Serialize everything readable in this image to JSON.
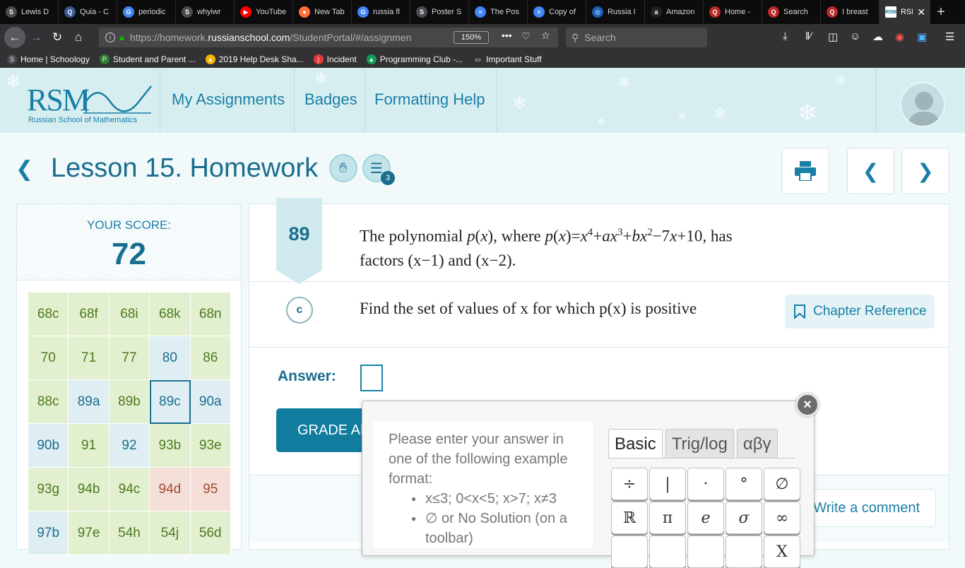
{
  "browser": {
    "tabs": [
      {
        "label": "Lewis D",
        "icon": "S",
        "color": "#4a4a4f"
      },
      {
        "label": "Quia - C",
        "icon": "Q",
        "color": "#3b5998"
      },
      {
        "label": "periodic",
        "icon": "G",
        "color": "#4285f4"
      },
      {
        "label": "whyiwr",
        "icon": "S",
        "color": "#4a4a4f"
      },
      {
        "label": "YouTube",
        "icon": "▶",
        "color": "#ff0000"
      },
      {
        "label": "New Tab",
        "icon": "●",
        "color": "#ff7139"
      },
      {
        "label": "russia fl",
        "icon": "G",
        "color": "#4285f4"
      },
      {
        "label": "Poster S",
        "icon": "S",
        "color": "#4a4a4f"
      },
      {
        "label": "The Pos",
        "icon": "≡",
        "color": "#4285f4"
      },
      {
        "label": "Copy of",
        "icon": "≡",
        "color": "#4285f4"
      },
      {
        "label": "Russia I",
        "icon": "◎",
        "color": "#1a5fb4"
      },
      {
        "label": "Amazon",
        "icon": "a",
        "color": "#222"
      },
      {
        "label": "Home -",
        "icon": "Q",
        "color": "#b92b27"
      },
      {
        "label": "Search",
        "icon": "Q",
        "color": "#b92b27"
      },
      {
        "label": "I breast",
        "icon": "Q",
        "color": "#b92b27"
      }
    ],
    "active_tab": {
      "label": "RSM",
      "icon": "RSM"
    },
    "new_tab": "+",
    "url_prefix": "https://homework.",
    "url_domain": "russianschool.com",
    "url_rest": "/StudentPortal/#/assignmen",
    "zoom": "150%",
    "search_placeholder": "Search",
    "bookmarks": [
      {
        "label": "Home | Schoology",
        "icon": "S"
      },
      {
        "label": "Student and Parent ...",
        "icon": "P"
      },
      {
        "label": "2019 Help Desk Sha...",
        "icon": "▲"
      },
      {
        "label": "Incident",
        "icon": ")"
      },
      {
        "label": "Programming Club -...",
        "icon": "▲"
      },
      {
        "label": "Important Stuff",
        "icon": "▭"
      }
    ]
  },
  "header": {
    "logo_text": "RSM",
    "logo_sub": "Russian School of Mathematics",
    "nav": [
      "My Assignments",
      "Badges",
      "Formatting Help"
    ]
  },
  "page": {
    "title": "Lesson 15. Homework",
    "badge_count": "3"
  },
  "score": {
    "label": "YOUR SCORE:",
    "value": "72",
    "problems": [
      {
        "id": "68c",
        "status": "g"
      },
      {
        "id": "68f",
        "status": "g"
      },
      {
        "id": "68i",
        "status": "g"
      },
      {
        "id": "68k",
        "status": "g"
      },
      {
        "id": "68n",
        "status": "g"
      },
      {
        "id": "70",
        "status": "g"
      },
      {
        "id": "71",
        "status": "g"
      },
      {
        "id": "77",
        "status": "g"
      },
      {
        "id": "80",
        "status": "b"
      },
      {
        "id": "86",
        "status": "g"
      },
      {
        "id": "88c",
        "status": "g"
      },
      {
        "id": "89a",
        "status": "b"
      },
      {
        "id": "89b",
        "status": "g"
      },
      {
        "id": "89c",
        "status": "sel"
      },
      {
        "id": "90a",
        "status": "b"
      },
      {
        "id": "90b",
        "status": "b"
      },
      {
        "id": "91",
        "status": "g"
      },
      {
        "id": "92",
        "status": "b"
      },
      {
        "id": "93b",
        "status": "g"
      },
      {
        "id": "93e",
        "status": "g"
      },
      {
        "id": "93g",
        "status": "g"
      },
      {
        "id": "94b",
        "status": "g"
      },
      {
        "id": "94c",
        "status": "g"
      },
      {
        "id": "94d",
        "status": "r"
      },
      {
        "id": "95",
        "status": "r"
      },
      {
        "id": "97b",
        "status": "b"
      },
      {
        "id": "97e",
        "status": "g"
      },
      {
        "id": "54h",
        "status": "g"
      },
      {
        "id": "54j",
        "status": "g"
      },
      {
        "id": "56d",
        "status": "g"
      }
    ]
  },
  "problem": {
    "number": "89",
    "statement_line1_pre": "The polynomial ",
    "statement_line2": "factors (x−1) and (x−2).",
    "part": "c",
    "part_text": "Find the set of values of x for which p(x) is positive",
    "chapter_reference": "Chapter Reference",
    "answer_label": "Answer:",
    "grade_button": "GRADE AN",
    "comment_button": "Write a comment"
  },
  "keyboard": {
    "close": "×",
    "help_intro": "Please enter your answer in one of the following example format:",
    "examples": [
      "x≤3; 0<x<5; x>7; x≠3",
      "∅ or No Solution (on a toolbar)"
    ],
    "tabs": [
      "Basic",
      "Trig/log",
      "αβγ"
    ],
    "active_tab": "Basic",
    "keys": [
      "÷",
      "|",
      "·",
      "°",
      "∅",
      "ℝ",
      "π",
      "e",
      "σ",
      "∞",
      "",
      "",
      "",
      "",
      "X"
    ]
  }
}
